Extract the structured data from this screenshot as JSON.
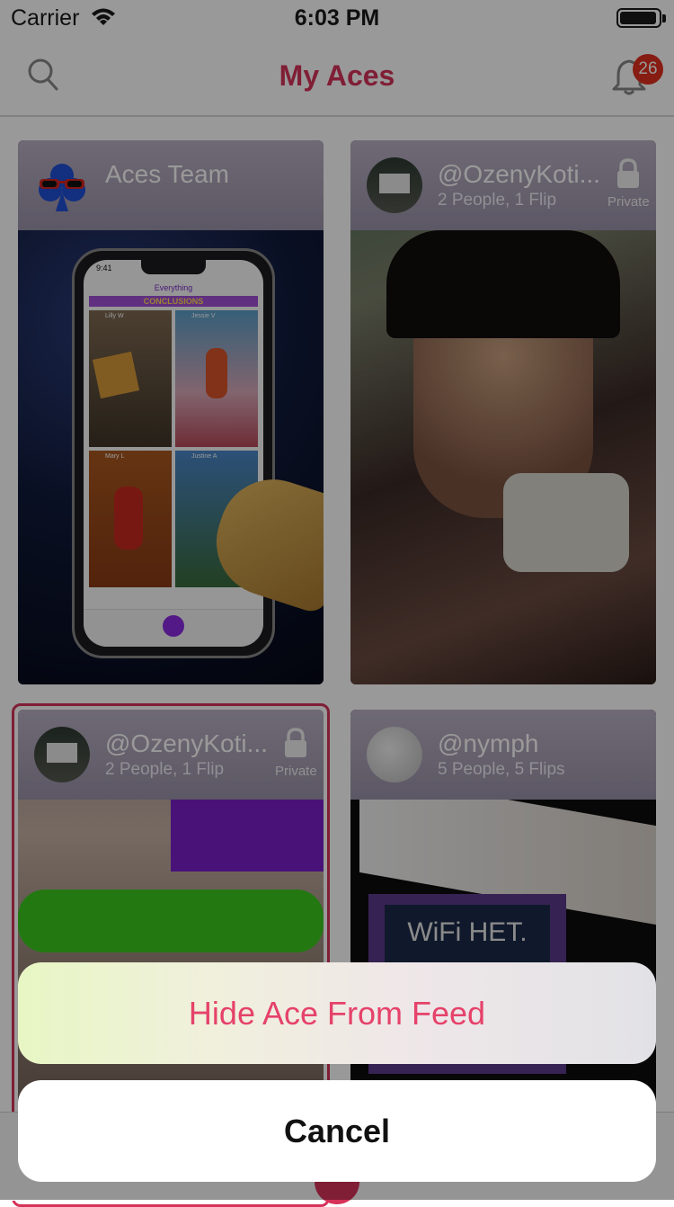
{
  "status_bar": {
    "carrier": "Carrier",
    "time": "6:03 PM"
  },
  "nav": {
    "title": "My Aces",
    "notification_count": "26"
  },
  "cards": [
    {
      "title": "Aces Team",
      "subtitle": ""
    },
    {
      "title": "@OzenyKoti...",
      "subtitle": "2 People, 1 Flip",
      "privacy": "Private"
    },
    {
      "title": "@OzenyKoti...",
      "subtitle": "2 People, 1 Flip",
      "privacy": "Private"
    },
    {
      "title": "@nymph",
      "subtitle": "5 People, 5 Flips"
    }
  ],
  "phone_preview": {
    "time": "9:41",
    "title": "Everything",
    "banner": "CONCLUSIONS",
    "tiles": [
      "Lilly W",
      "Jessie V",
      "Mary L",
      "Justine A"
    ]
  },
  "nymph_preview": {
    "sign_text": "WiFi НЕТ."
  },
  "action_sheet": {
    "hide_label": "Hide Ace From Feed",
    "cancel_label": "Cancel"
  },
  "colors": {
    "accent": "#d6325a",
    "badge": "#e0301e",
    "selected_border": "#d6325a"
  }
}
